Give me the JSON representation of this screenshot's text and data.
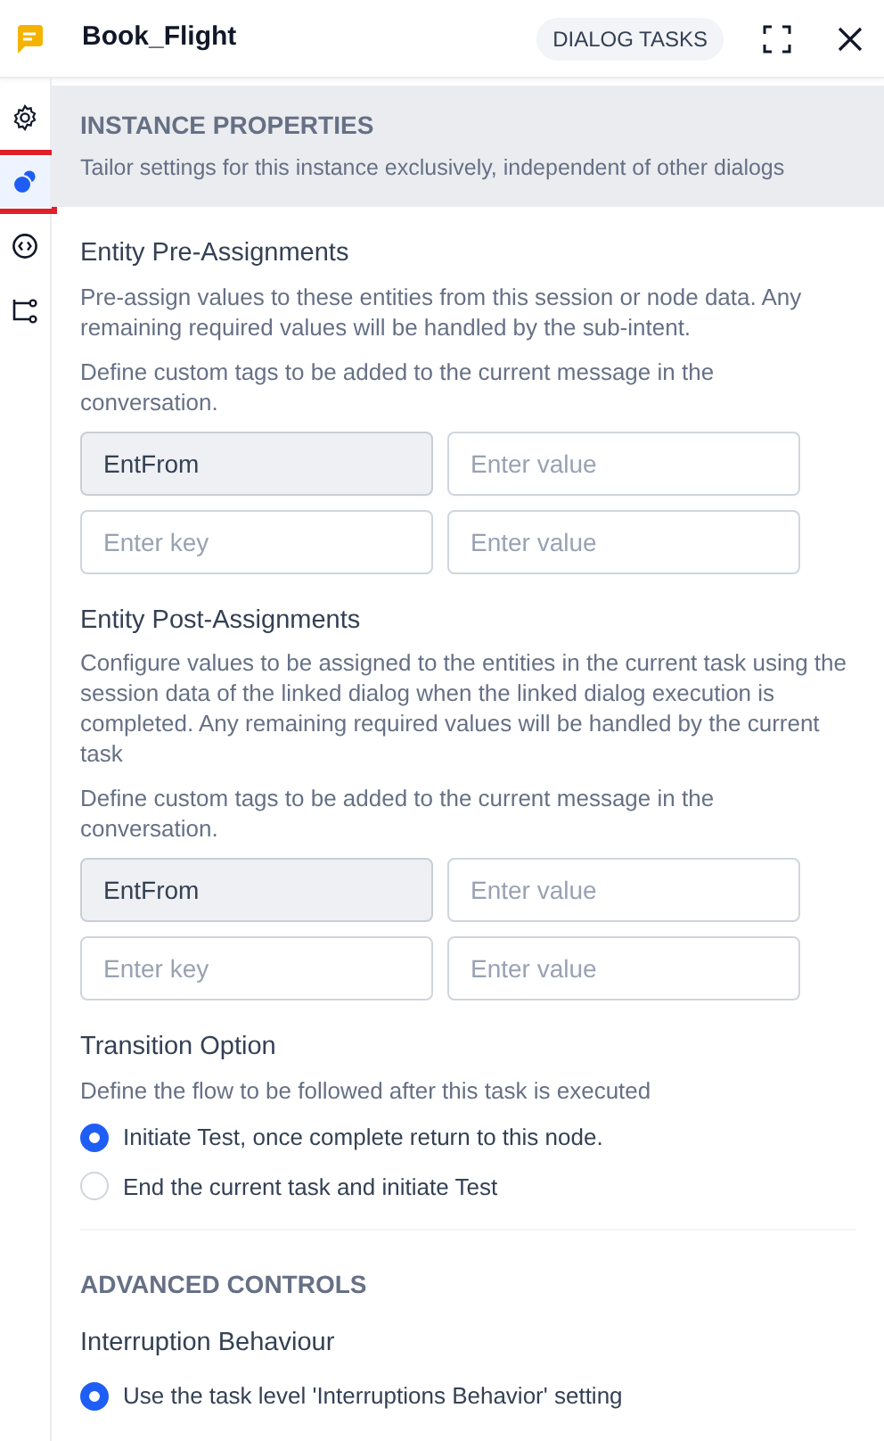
{
  "header": {
    "title": "Book_Flight",
    "tag": "DIALOG TASKS"
  },
  "sidebar": {
    "items": [
      {
        "selected": false
      },
      {
        "selected": true
      },
      {
        "selected": false
      },
      {
        "selected": false
      }
    ]
  },
  "banner": {
    "title": "INSTANCE PROPERTIES",
    "subtitle": "Tailor settings for this instance exclusively, independent of other dialogs"
  },
  "sections": [
    {
      "kind": "assign",
      "title": "Entity Pre-Assignments",
      "description": "Pre-assign values to these entities from this session or node data. Any remaining required values will be handled by the sub-intent.",
      "hint": "Define custom tags to be added to the current message in the conversation.",
      "rows": [
        {
          "key": {
            "value": "EntFrom",
            "readonly": true
          },
          "value": {
            "placeholder": "Enter value"
          }
        },
        {
          "key": {
            "placeholder": "Enter key",
            "readonly": false
          },
          "value": {
            "placeholder": "Enter value"
          }
        }
      ]
    },
    {
      "kind": "assign",
      "title": "Entity Post-Assignments",
      "description": "Configure values to be assigned to the entities in the current task using the session data of the linked dialog when the linked dialog execution is completed. Any remaining required values will be handled by the current task",
      "hint": "Define custom tags to be added to the current message in the conversation.",
      "rows": [
        {
          "key": {
            "value": "EntFrom",
            "readonly": true
          },
          "value": {
            "placeholder": "Enter value"
          }
        },
        {
          "key": {
            "placeholder": "Enter key",
            "readonly": false
          },
          "value": {
            "placeholder": "Enter value"
          }
        }
      ]
    },
    {
      "kind": "radio",
      "title": "Transition Option",
      "description": "Define the flow to be followed after this task is executed",
      "options": [
        {
          "label": "Initiate Test, once complete return to this node.",
          "selected": true
        },
        {
          "label": "End the current task and initiate Test",
          "selected": false
        }
      ]
    },
    {
      "kind": "heading",
      "title": "ADVANCED CONTROLS"
    },
    {
      "kind": "radio",
      "title": "Interruption Behaviour",
      "options": [
        {
          "label": "Use the task level 'Interruptions Behavior' setting",
          "selected": true
        }
      ]
    }
  ]
}
